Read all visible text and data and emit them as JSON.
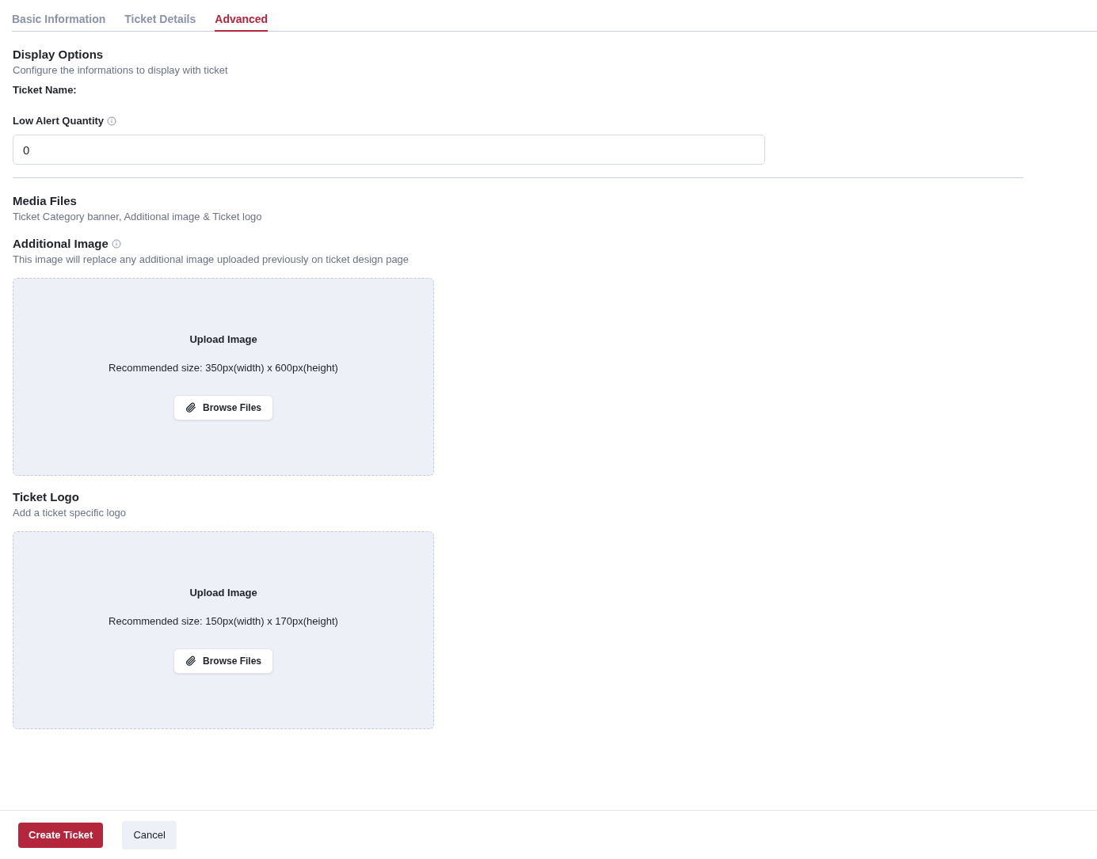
{
  "tabs": [
    {
      "label": "Basic Information",
      "selected": false
    },
    {
      "label": "Ticket Details",
      "selected": false
    },
    {
      "label": "Advanced",
      "selected": true
    }
  ],
  "display_options": {
    "title": "Display Options",
    "description": "Configure the informations to display with ticket",
    "ticket_name_label": "Ticket Name:",
    "low_alert_quantity": {
      "label": "Low Alert Quantity",
      "value": "0"
    }
  },
  "media_files": {
    "title": "Media Files",
    "description": "Ticket Category banner, Additional image & Ticket logo",
    "uploads": [
      {
        "title": "Additional Image",
        "info": true,
        "description": "This image will replace any additional image uploaded previously on ticket design page",
        "heading": "Upload Image",
        "hint": "Recommended size: 350px(width) x 600px(height)",
        "button": "Browse Files"
      },
      {
        "title": "Ticket Logo",
        "info": false,
        "description": "Add a ticket specific logo",
        "heading": "Upload Image",
        "hint": "Recommended size: 150px(width) x 170px(height)",
        "button": "Browse Files"
      }
    ]
  },
  "footer": {
    "primary_button": "Create Ticket",
    "secondary_button": "Cancel"
  }
}
